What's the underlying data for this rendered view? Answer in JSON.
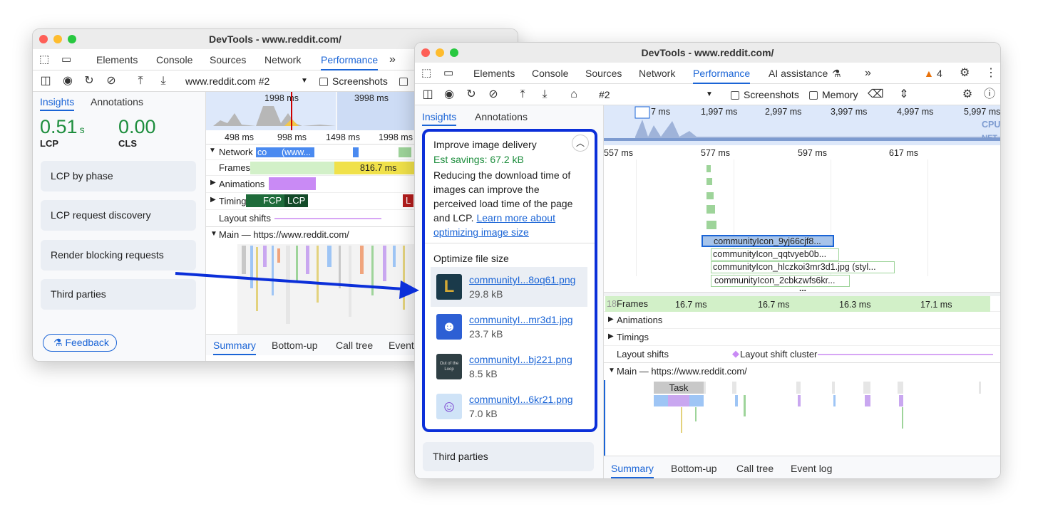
{
  "left": {
    "title": "DevTools - www.reddit.com/",
    "tabs": [
      "Elements",
      "Console",
      "Sources",
      "Network",
      "Performance"
    ],
    "active_tab": "Performance",
    "recording": "www.reddit.com #2",
    "screenshots_label": "Screenshots",
    "sidebar_tabs": [
      "Insights",
      "Annotations"
    ],
    "lcp_value": "0.51",
    "lcp_unit": "s",
    "lcp_label": "LCP",
    "cls_value": "0.00",
    "cls_label": "CLS",
    "insights": [
      "LCP by phase",
      "LCP request discovery",
      "Render blocking requests",
      "Third parties"
    ],
    "feedback": "Feedback",
    "overview_ticks": [
      "1998 ms",
      "3998 ms"
    ],
    "ruler_ticks": [
      "498 ms",
      "998 ms",
      "1498 ms",
      "1998 ms"
    ],
    "tracks": {
      "network": "Network",
      "network_item1": "co",
      "network_item2": "(www...",
      "frames": "Frames",
      "frames_value": "816.7 ms",
      "animations": "Animations",
      "timings": "Timings",
      "fcp": "FCP",
      "lcp": "LCP",
      "l": "L",
      "layout_shifts": "Layout shifts",
      "main": "Main — https://www.reddit.com/"
    },
    "bottom_tabs": [
      "Summary",
      "Bottom-up",
      "Call tree",
      "Event"
    ]
  },
  "right": {
    "title": "DevTools - www.reddit.com/",
    "tabs": [
      "Elements",
      "Console",
      "Sources",
      "Network",
      "Performance",
      "AI assistance"
    ],
    "active_tab": "Performance",
    "warnings": "4",
    "recording": "#2",
    "screenshots_label": "Screenshots",
    "memory_label": "Memory",
    "sidebar_tabs": [
      "Insights",
      "Annotations"
    ],
    "insight": {
      "title": "Improve image delivery",
      "savings": "Est savings: 67.2 kB",
      "desc": "Reducing the download time of images can improve the perceived load time of the page and LCP.",
      "link": "Learn more about optimizing image size",
      "section": "Optimize file size",
      "files": [
        {
          "name": "communityI...8oq61.png",
          "size": "29.8 kB",
          "thumb_color": "#1a3a4a",
          "icon": "league-logo-icon"
        },
        {
          "name": "communityI...mr3d1.jpg",
          "size": "23.7 kB",
          "thumb_color": "#2d5fd4",
          "icon": "discord-logo-icon"
        },
        {
          "name": "communityI...bj221.png",
          "size": "8.5 kB",
          "thumb_color": "#2f3f44",
          "icon": "out-of-the-loop-icon",
          "thumb_text": "Out of the Loop"
        },
        {
          "name": "communityI...6kr21.png",
          "size": "7.0 kB",
          "thumb_color": "#cfe3f7",
          "icon": "reddit-snoo-icon"
        }
      ]
    },
    "third_parties": "Third parties",
    "overview_ticks": [
      "7 ms",
      "1,997 ms",
      "2,997 ms",
      "3,997 ms",
      "4,997 ms",
      "5,997 ms"
    ],
    "cpu_label": "CPU",
    "net_label": "NET",
    "ruler_ticks": [
      "557 ms",
      "577 ms",
      "597 ms",
      "617 ms"
    ],
    "network_items": [
      "communityIcon_9yj66cjf8...",
      "communityIcon_qqtvyeb0b...",
      "communityIcon_hlczkoi3mr3d1.jpg (styl...",
      "communityIcon_2cbkzwfs6kr..."
    ],
    "ellipsis": "...",
    "frames_label": "Frames",
    "frame_values": [
      "16.7 ms",
      "16.7 ms",
      "16.3 ms",
      "17.1 ms"
    ],
    "frames_prefix": "18",
    "animations": "Animations",
    "timings": "Timings",
    "layout_shifts": "Layout shifts",
    "layout_shift_cluster": "Layout shift cluster",
    "main": "Main — https://www.reddit.com/",
    "task": "Task",
    "bottom_tabs": [
      "Summary",
      "Bottom-up",
      "Call tree",
      "Event log"
    ]
  },
  "colors": {
    "accent": "#1a64d6",
    "green": "#1e8e3e",
    "highlight": "#0b2fd9",
    "frames": "#d2f0c8",
    "network": "#4a8af0",
    "animation": "#c98af5",
    "timing": "#1e6b3a"
  }
}
